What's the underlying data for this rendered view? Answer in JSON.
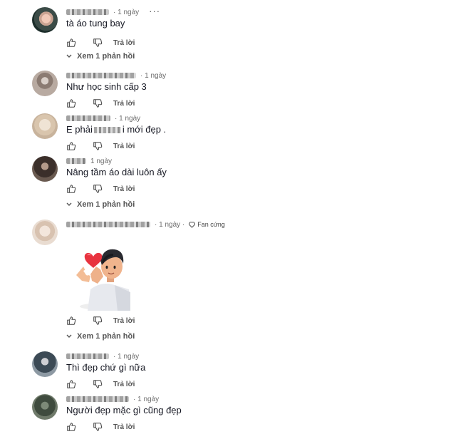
{
  "labels": {
    "reply": "Trả lời",
    "view_replies": "Xem 1 phản hồi",
    "more": "···"
  },
  "comments": [
    {
      "time": "· 1 ngày",
      "text": "tà áo tung bay",
      "name_width": 60
    },
    {
      "time": "· 1 ngày",
      "text": "Như học sinh cấp 3",
      "name_width": 98
    },
    {
      "time": "· 1 ngày",
      "text_before": "E phải",
      "text_after": "i mới đẹp .",
      "name_width": 62
    },
    {
      "time": "1 ngày",
      "text": "Nâng tầm áo dài luôn ấy",
      "name_width": 28
    },
    {
      "time": "· 1 ngày ·",
      "badge": "Fan cứng",
      "text": "",
      "name_width": 118
    },
    {
      "time": "· 1 ngày",
      "text": "Thì đẹp chứ gì nữa",
      "name_width": 60
    },
    {
      "time": "· 1 ngày",
      "text": "Người đẹp mặc gì cũng đẹp",
      "name_width": 88
    }
  ],
  "colors": {
    "text": "#161823",
    "muted": "#6b6b6b",
    "heart": "#e8333f"
  }
}
